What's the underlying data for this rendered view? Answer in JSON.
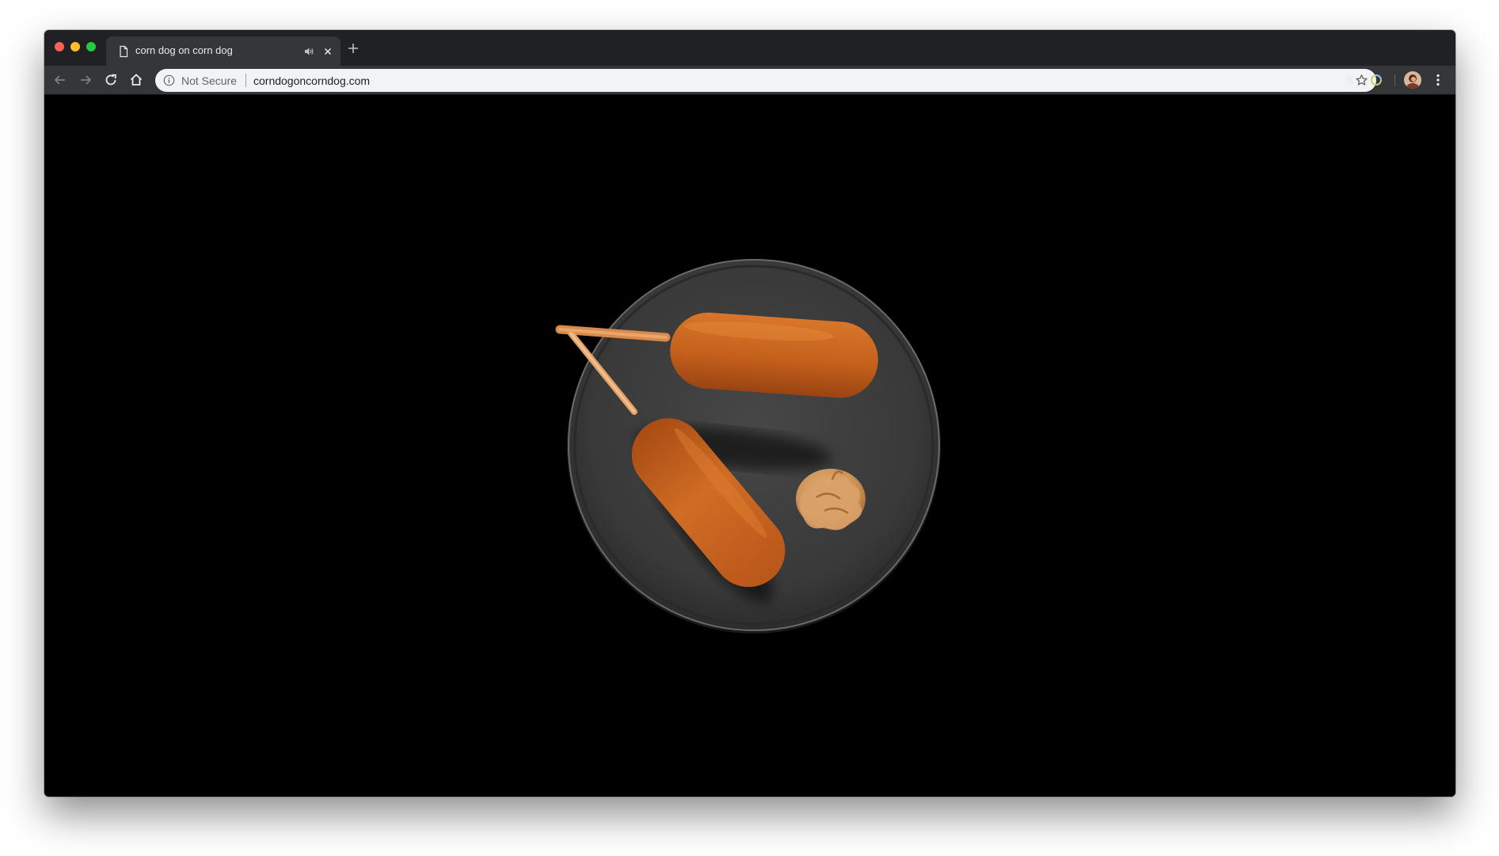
{
  "window": {
    "controls": [
      "close",
      "minimize",
      "zoom"
    ]
  },
  "tabs": [
    {
      "title": "corn dog on corn dog",
      "icon": "page-icon",
      "audio_icon": "speaker-icon",
      "active": true
    }
  ],
  "toolbar": {
    "back_icon": "arrow-left-icon",
    "forward_icon": "arrow-right-icon",
    "reload_icon": "reload-icon",
    "home_icon": "home-icon",
    "security_label": "Not Secure",
    "url": "corndogoncorndog.com",
    "bookmark_icon": "star-icon",
    "extensions": [
      {
        "label": "K",
        "icon": "k-extension-icon"
      },
      {
        "label": "",
        "icon": "ring-extension-icon"
      }
    ],
    "menu_icon": "kebab-menu-icon"
  },
  "content": {
    "image": "photo of two corn dogs on a dark plate with a dollop of mustard on a black background"
  },
  "colors": {
    "tabstrip_bg": "#202124",
    "toolbar_bg": "#35363a",
    "omnibox_bg": "#f1f3f4",
    "page_bg": "#000000",
    "plate": "#3f3f3f",
    "corndog": "#c8631f",
    "mustard": "#d49a5c"
  }
}
